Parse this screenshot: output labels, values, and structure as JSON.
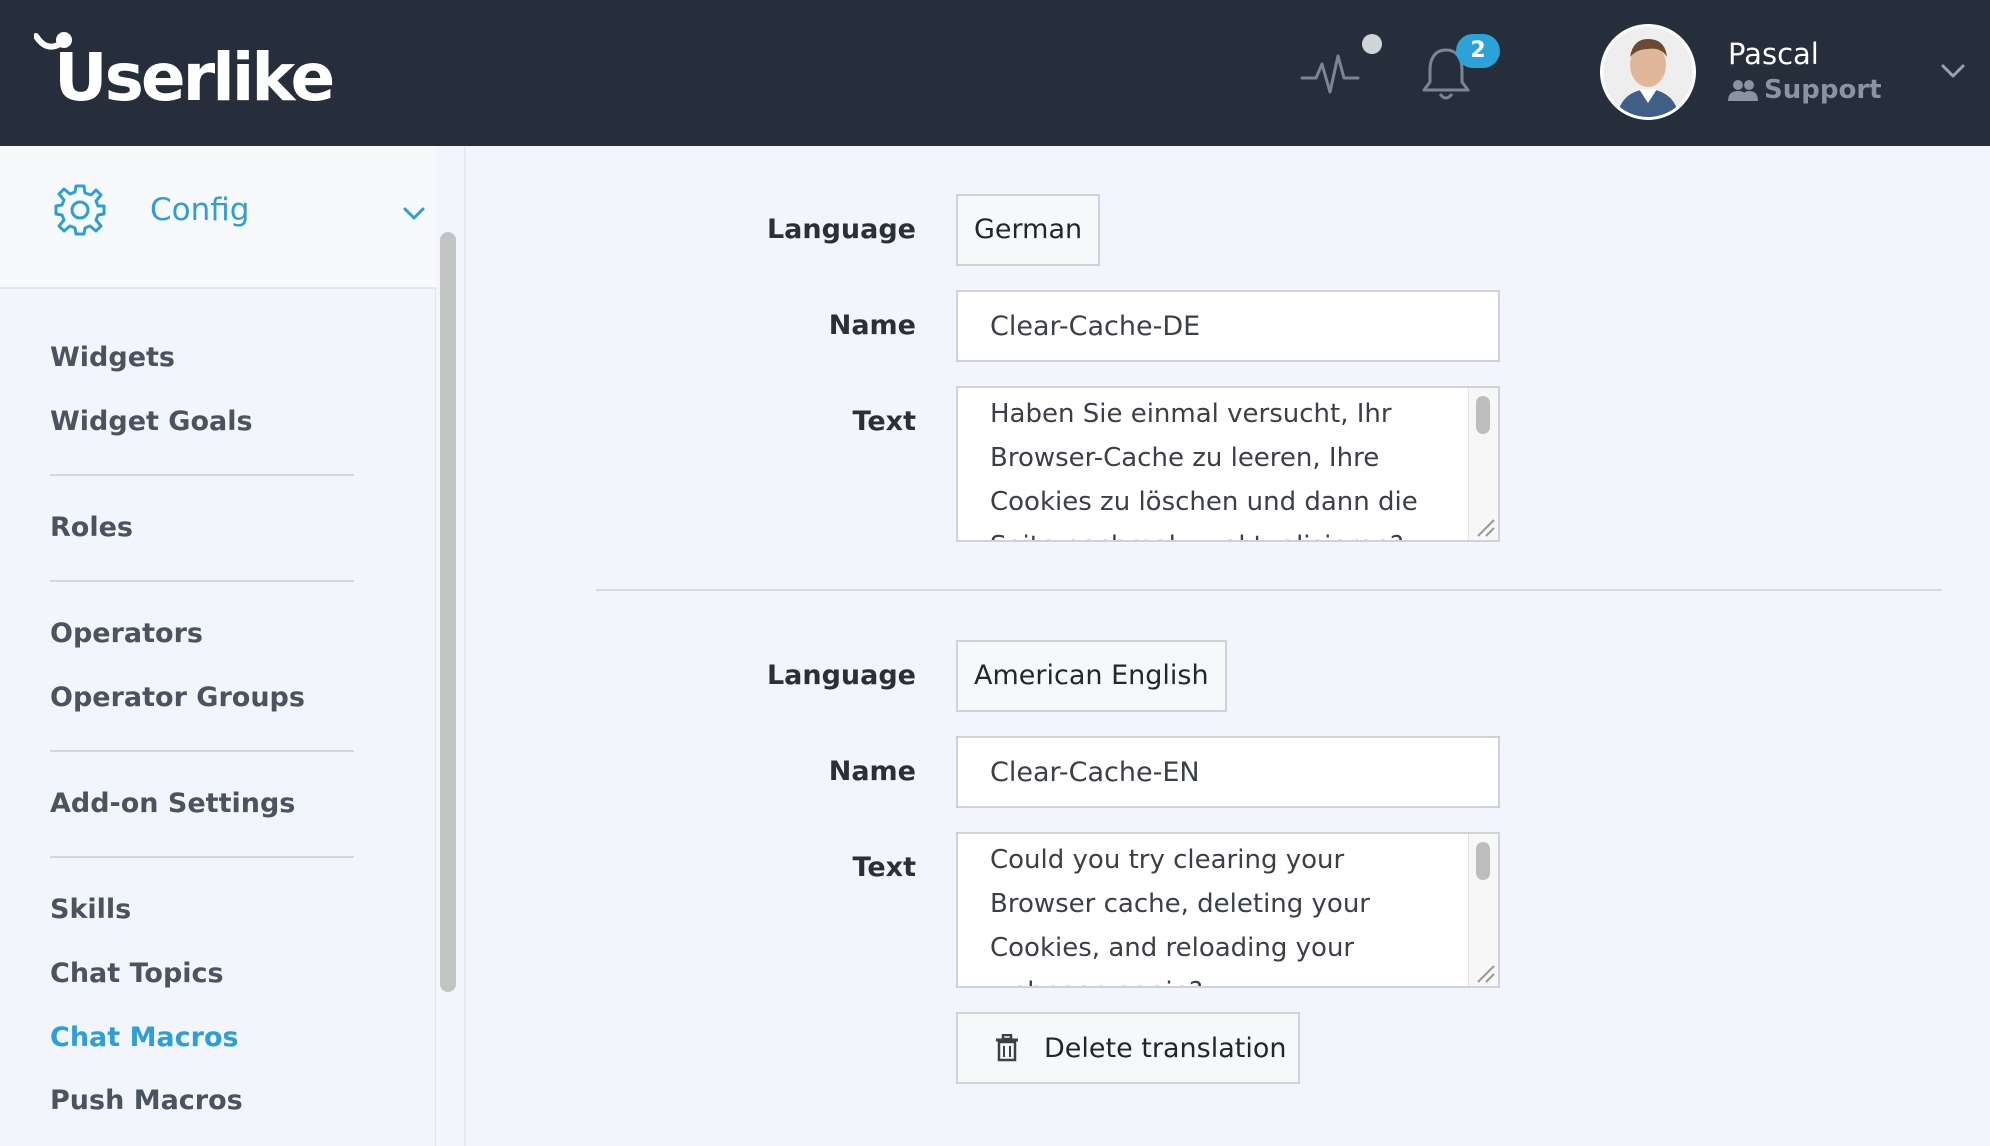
{
  "app": {
    "brand": "Userlike"
  },
  "header": {
    "notification_count": "2",
    "user": {
      "name": "Pascal",
      "role": "Support"
    }
  },
  "sidebar": {
    "section_title": "Config",
    "items": [
      {
        "label": "Widgets",
        "active": false
      },
      {
        "label": "Widget Goals",
        "active": false
      },
      {
        "label": "Roles",
        "active": false
      },
      {
        "label": "Operators",
        "active": false
      },
      {
        "label": "Operator Groups",
        "active": false
      },
      {
        "label": "Add-on Settings",
        "active": false
      },
      {
        "label": "Skills",
        "active": false
      },
      {
        "label": "Chat Topics",
        "active": false
      },
      {
        "label": "Chat Macros",
        "active": true
      },
      {
        "label": "Push Macros",
        "active": false
      }
    ]
  },
  "form": {
    "labels": {
      "language": "Language",
      "name": "Name",
      "text": "Text"
    },
    "translations": [
      {
        "language": "German",
        "name": "Clear-Cache-DE",
        "text": "Haben Sie einmal versucht, Ihr Browser-Cache zu leeren, Ihre Cookies zu löschen und dann die Seite nochmal zu aktualisieren?"
      },
      {
        "language": "American English",
        "name": "Clear-Cache-EN",
        "text": "Could you try clearing your Browser cache, deleting your Cookies, and reloading your webpage again?"
      }
    ],
    "delete_label": "Delete translation"
  },
  "colors": {
    "header_bg": "#262d3b",
    "accent": "#2d9fd6",
    "page_bg": "#f2f5fb"
  }
}
